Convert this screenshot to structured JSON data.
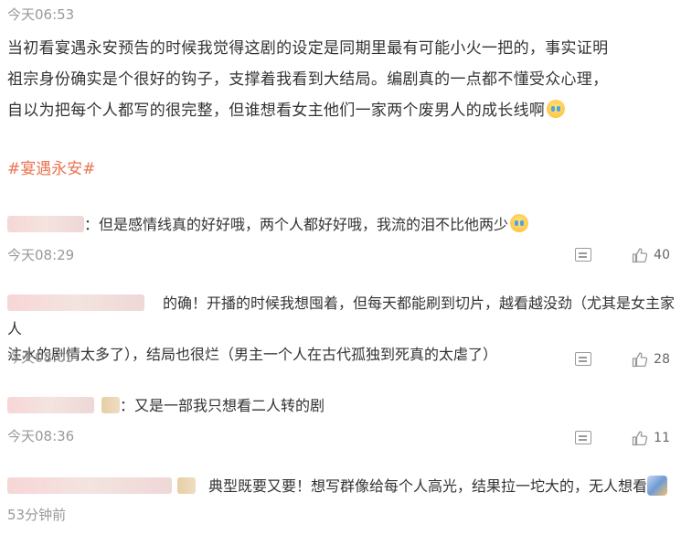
{
  "post": {
    "time": "今天06:53",
    "lines": [
      "当初看宴遇永安预告的时候我觉得这剧的设定是同期里最有可能小火一把的，事实证明",
      "祖宗身份确实是个很好的钩子，支撑着我看到大结局。编剧真的一点都不懂受众心理，",
      "自以为把每个人都写的很完整，但谁想看女主他们一家两个废男人的成长线啊"
    ],
    "topic": "#宴遇永安#"
  },
  "comments": [
    {
      "text": "：但是感情线真的好好哦，两个人都好好哦，我流的泪不比他两少",
      "time": "今天08:29",
      "likes": "40"
    },
    {
      "text_line1": "的确！开播的时候我想囤着，但每天都能刷到切片，越看越没劲（尤其是女主家人",
      "text_line2": "注水的剧情太多了），结局也很烂（男主一个人在古代孤独到死真的太虐了）",
      "time": "今天08:05",
      "likes": "28"
    },
    {
      "text": "：又是一部我只想看二人转的剧",
      "time": "今天08:36",
      "likes": "11"
    },
    {
      "text": "典型既要又要！想写群像给每个人高光，结果拉一坨大的，无人想看",
      "time": "53分钟前"
    }
  ],
  "icons": {
    "comment": "comment-icon",
    "like": "thumbs-up-icon"
  },
  "colors": {
    "topic": "#eb7350",
    "meta": "#999999",
    "text": "#333333"
  }
}
